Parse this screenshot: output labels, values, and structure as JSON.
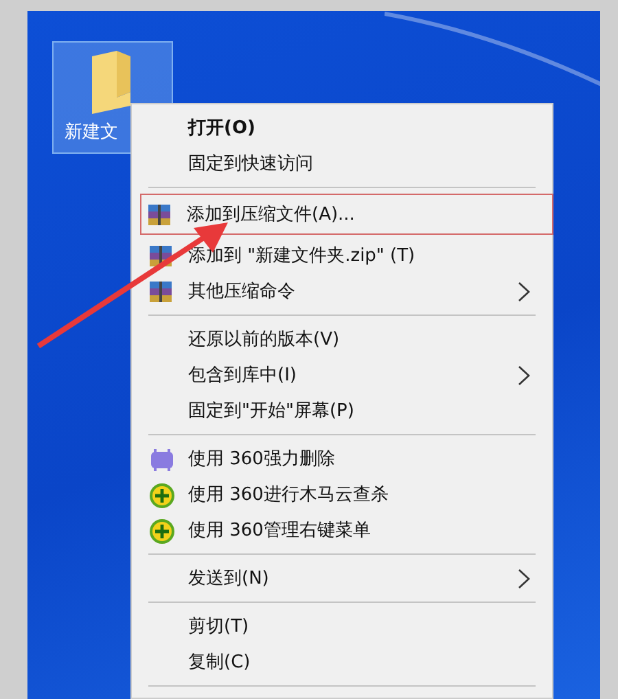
{
  "desktop": {
    "icons": [
      {
        "label": "新建文",
        "selected": true
      }
    ]
  },
  "context_menu": {
    "items": [
      {
        "kind": "plain",
        "label": "打开(O)",
        "default": true,
        "selected": false
      },
      {
        "kind": "plain",
        "label": "固定到快速访问",
        "selected": false
      },
      {
        "kind": "separator"
      },
      {
        "kind": "archive",
        "label": "添加到压缩文件(A)...",
        "selected": true
      },
      {
        "kind": "archive",
        "label": "添加到 \"新建文件夹.zip\" (T)",
        "selected": false
      },
      {
        "kind": "archive",
        "label": "其他压缩命令",
        "submenu": true,
        "selected": false
      },
      {
        "kind": "separator"
      },
      {
        "kind": "plain",
        "label": "还原以前的版本(V)",
        "selected": false
      },
      {
        "kind": "plain",
        "label": "包含到库中(I)",
        "submenu": true,
        "selected": false
      },
      {
        "kind": "plain",
        "label": "固定到\"开始\"屏幕(P)",
        "selected": false
      },
      {
        "kind": "separator"
      },
      {
        "kind": "shredder",
        "label": "使用 360强力删除",
        "selected": false
      },
      {
        "kind": "shield",
        "label": "使用 360进行木马云查杀",
        "selected": false
      },
      {
        "kind": "shield",
        "label": "使用 360管理右键菜单",
        "selected": false
      },
      {
        "kind": "separator"
      },
      {
        "kind": "plain",
        "label": "发送到(N)",
        "submenu": true,
        "selected": false
      },
      {
        "kind": "separator"
      },
      {
        "kind": "plain",
        "label": "剪切(T)",
        "selected": false
      },
      {
        "kind": "plain",
        "label": "复制(C)",
        "selected": false
      },
      {
        "kind": "separator"
      }
    ]
  }
}
